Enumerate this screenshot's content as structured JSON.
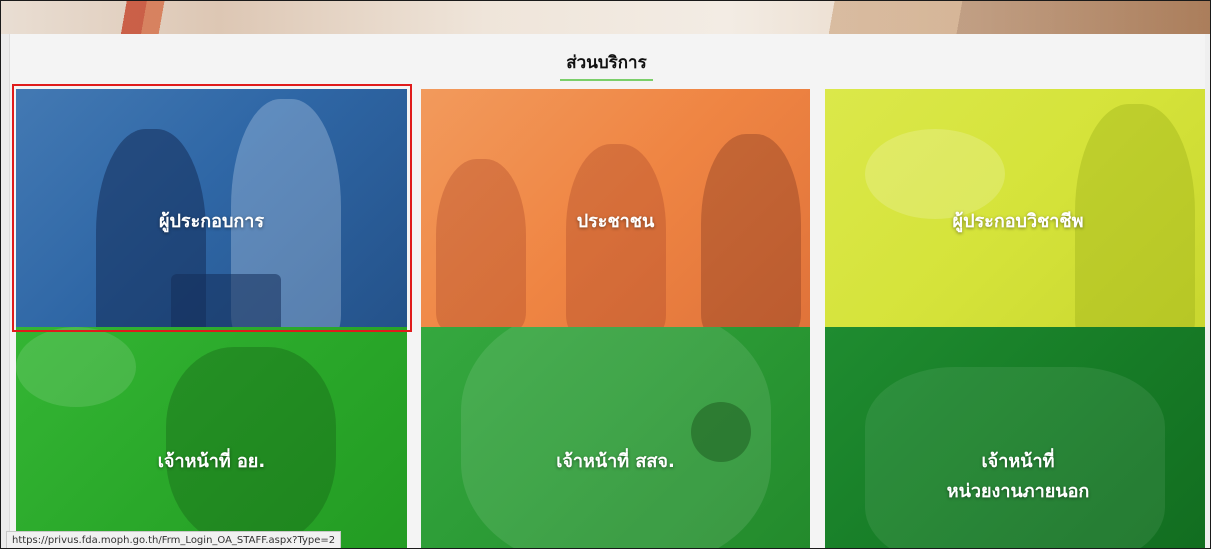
{
  "section": {
    "title": "ส่วนบริการ"
  },
  "tiles": [
    {
      "id": "operator",
      "label": "ผู้ประกอบการ",
      "color": "#2f67a6",
      "selected": true
    },
    {
      "id": "public",
      "label": "ประชาชน",
      "color": "#ef8543"
    },
    {
      "id": "professional",
      "label": "ผู้ประกอบวิชาชีพ",
      "color": "#d5e33a"
    },
    {
      "id": "fda-staff",
      "label": "เจ้าหน้าที่ อย.",
      "color": "#2aa82a"
    },
    {
      "id": "provincial-staff",
      "label": "เจ้าหน้าที่ สสจ.",
      "color": "#2b9a35"
    },
    {
      "id": "external-staff",
      "label_line1": "เจ้าหน้าที่",
      "label_line2": "หน่วยงานภายนอก",
      "color": "#177d27"
    }
  ],
  "status_bar": {
    "url": "https://privus.fda.moph.go.th/Frm_Login_OA_STAFF.aspx?Type=2"
  },
  "colors": {
    "selection_outline": "#e01b1b",
    "title_underline": "#7bcf6a"
  }
}
